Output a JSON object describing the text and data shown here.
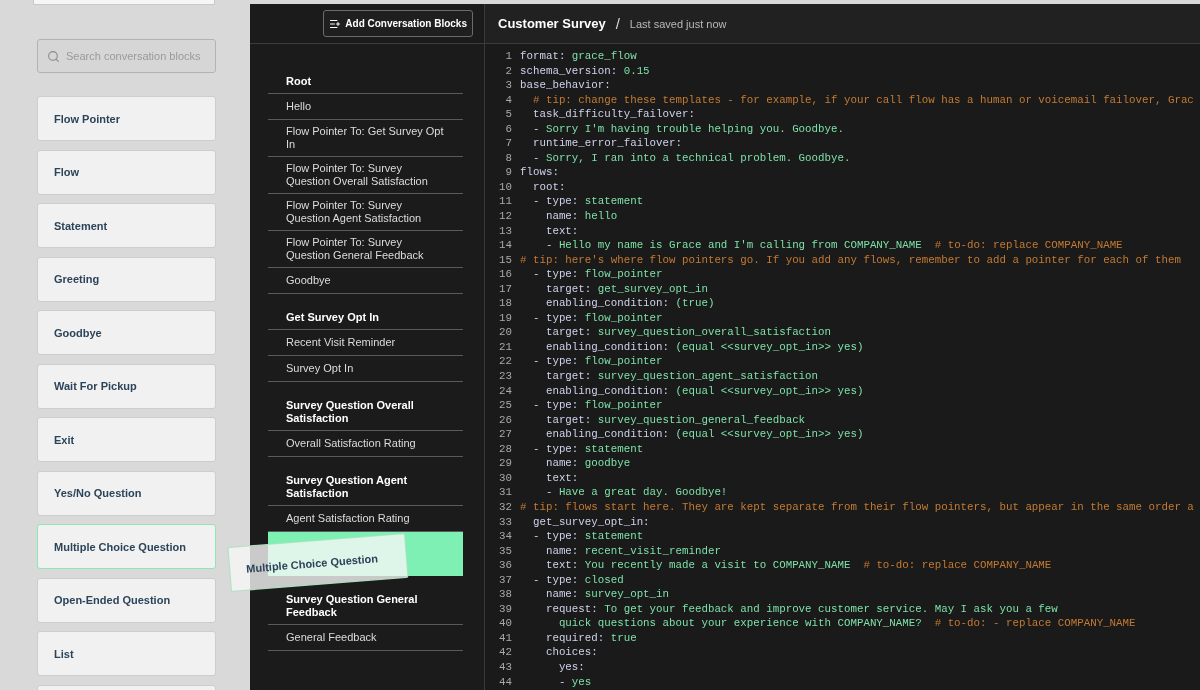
{
  "palette": {
    "search": {
      "placeholder": "Search conversation blocks"
    },
    "blocks": [
      {
        "label": "Flow Pointer",
        "dragging": false
      },
      {
        "label": "Flow",
        "dragging": false
      },
      {
        "label": "Statement",
        "dragging": false
      },
      {
        "label": "Greeting",
        "dragging": false
      },
      {
        "label": "Goodbye",
        "dragging": false
      },
      {
        "label": "Wait For Pickup",
        "dragging": false
      },
      {
        "label": "Exit",
        "dragging": false
      },
      {
        "label": "Yes/No Question",
        "dragging": false
      },
      {
        "label": "Multiple Choice Question",
        "dragging": true
      },
      {
        "label": "Open-Ended Question",
        "dragging": false
      },
      {
        "label": "List",
        "dragging": false
      }
    ]
  },
  "drag_preview": {
    "label": "Multiple Choice Question"
  },
  "outline": {
    "add_button": "Add Conversation Blocks",
    "sections": [
      {
        "title": "Root",
        "items": [
          {
            "kind": "block",
            "label": "Hello"
          },
          {
            "kind": "block",
            "label": "Flow Pointer To: Get Survey Opt In"
          },
          {
            "kind": "block",
            "label": "Flow Pointer To: Survey Question Overall Satisfaction"
          },
          {
            "kind": "block",
            "label": "Flow Pointer To: Survey Question Agent Satisfaction"
          },
          {
            "kind": "block",
            "label": "Flow Pointer To: Survey Question General Feedback"
          },
          {
            "kind": "block",
            "label": "Goodbye"
          }
        ]
      },
      {
        "title": "Get Survey Opt In",
        "items": [
          {
            "kind": "block",
            "label": "Recent Visit Reminder"
          },
          {
            "kind": "block",
            "label": "Survey Opt In"
          }
        ]
      },
      {
        "title": "Survey Question Overall Satisfaction",
        "items": [
          {
            "kind": "block",
            "label": "Overall Satisfaction Rating"
          }
        ]
      },
      {
        "title": "Survey Question Agent Satisfaction",
        "items": [
          {
            "kind": "block",
            "label": "Agent Satisfaction Rating"
          },
          {
            "kind": "drop_placeholder"
          }
        ]
      },
      {
        "title": "Survey Question General Feedback",
        "items": [
          {
            "kind": "block",
            "label": "General Feedback"
          }
        ]
      }
    ]
  },
  "editor": {
    "title": "Customer Survey",
    "separator": "/",
    "save_status": "Last saved just now",
    "lines": [
      {
        "number": "1",
        "key": "format:",
        "value": " grace_flow"
      },
      {
        "number": "2",
        "key": "schema_version:",
        "value": " 0.15"
      },
      {
        "number": "3",
        "key": "base_behavior:"
      },
      {
        "number": "4",
        "comment": "  # tip: change these templates - for example, if your call flow has a human or voicemail failover, Grac"
      },
      {
        "number": "5",
        "key": "  task_difficulty_failover:"
      },
      {
        "number": "6",
        "key": "  - ",
        "value": "Sorry I'm having trouble helping you. Goodbye."
      },
      {
        "number": "7",
        "key": "  runtime_error_failover:"
      },
      {
        "number": "8",
        "key": "  - ",
        "value": "Sorry, I ran into a technical problem. Goodbye."
      },
      {
        "number": "9",
        "key": "flows:"
      },
      {
        "number": "10",
        "key": "  root:"
      },
      {
        "number": "11",
        "key": "  - type:",
        "value": " statement"
      },
      {
        "number": "12",
        "key": "    name:",
        "value": " hello"
      },
      {
        "number": "13",
        "key": "    text:"
      },
      {
        "number": "14",
        "key": "    - ",
        "value": "Hello my name is Grace and I'm calling from COMPANY_NAME",
        "comment": "  # to-do: replace COMPANY_NAME"
      },
      {
        "number": "15",
        "comment": "# tip: here's where flow pointers go. If you add any flows, remember to add a pointer for each of them"
      },
      {
        "number": "16",
        "key": "  - type:",
        "value": " flow_pointer"
      },
      {
        "number": "17",
        "key": "    target:",
        "value": " get_survey_opt_in"
      },
      {
        "number": "18",
        "key": "    enabling_condition:",
        "value": " (true)"
      },
      {
        "number": "19",
        "key": "  - type:",
        "value": " flow_pointer"
      },
      {
        "number": "20",
        "key": "    target:",
        "value": " survey_question_overall_satisfaction"
      },
      {
        "number": "21",
        "key": "    enabling_condition:",
        "value": " (equal <<survey_opt_in>> yes)"
      },
      {
        "number": "22",
        "key": "  - type:",
        "value": " flow_pointer"
      },
      {
        "number": "23",
        "key": "    target:",
        "value": " survey_question_agent_satisfaction"
      },
      {
        "number": "24",
        "key": "    enabling_condition:",
        "value": " (equal <<survey_opt_in>> yes)"
      },
      {
        "number": "25",
        "key": "  - type:",
        "value": " flow_pointer"
      },
      {
        "number": "26",
        "key": "    target:",
        "value": " survey_question_general_feedback"
      },
      {
        "number": "27",
        "key": "    enabling_condition:",
        "value": " (equal <<survey_opt_in>> yes)"
      },
      {
        "number": "28",
        "key": "  - type:",
        "value": " statement"
      },
      {
        "number": "29",
        "key": "    name:",
        "value": " goodbye"
      },
      {
        "number": "30",
        "key": "    text:"
      },
      {
        "number": "31",
        "key": "    - ",
        "value": "Have a great day. Goodbye!"
      },
      {
        "number": "32",
        "comment": "# tip: flows start here. They are kept separate from their flow pointers, but appear in the same order a"
      },
      {
        "number": "33",
        "key": "  get_survey_opt_in:"
      },
      {
        "number": "34",
        "key": "  - type:",
        "value": " statement"
      },
      {
        "number": "35",
        "key": "    name:",
        "value": " recent_visit_reminder"
      },
      {
        "number": "36",
        "key": "    text:",
        "value": " You recently made a visit to COMPANY_NAME",
        "comment": "  # to-do: replace COMPANY_NAME"
      },
      {
        "number": "37",
        "key": "  - type:",
        "value": " closed"
      },
      {
        "number": "38",
        "key": "    name:",
        "value": " survey_opt_in"
      },
      {
        "number": "39",
        "key": "    request:",
        "value": " To get your feedback and improve customer service. May I ask you a few"
      },
      {
        "number": "40",
        "value": "      quick questions about your experience with COMPANY_NAME?",
        "comment": "  # to-do: - replace COMPANY_NAME"
      },
      {
        "number": "41",
        "key": "    required:",
        "value": " true"
      },
      {
        "number": "42",
        "key": "    choices:"
      },
      {
        "number": "43",
        "key": "      yes:"
      },
      {
        "number": "44",
        "key": "      - ",
        "value": "yes"
      }
    ]
  }
}
